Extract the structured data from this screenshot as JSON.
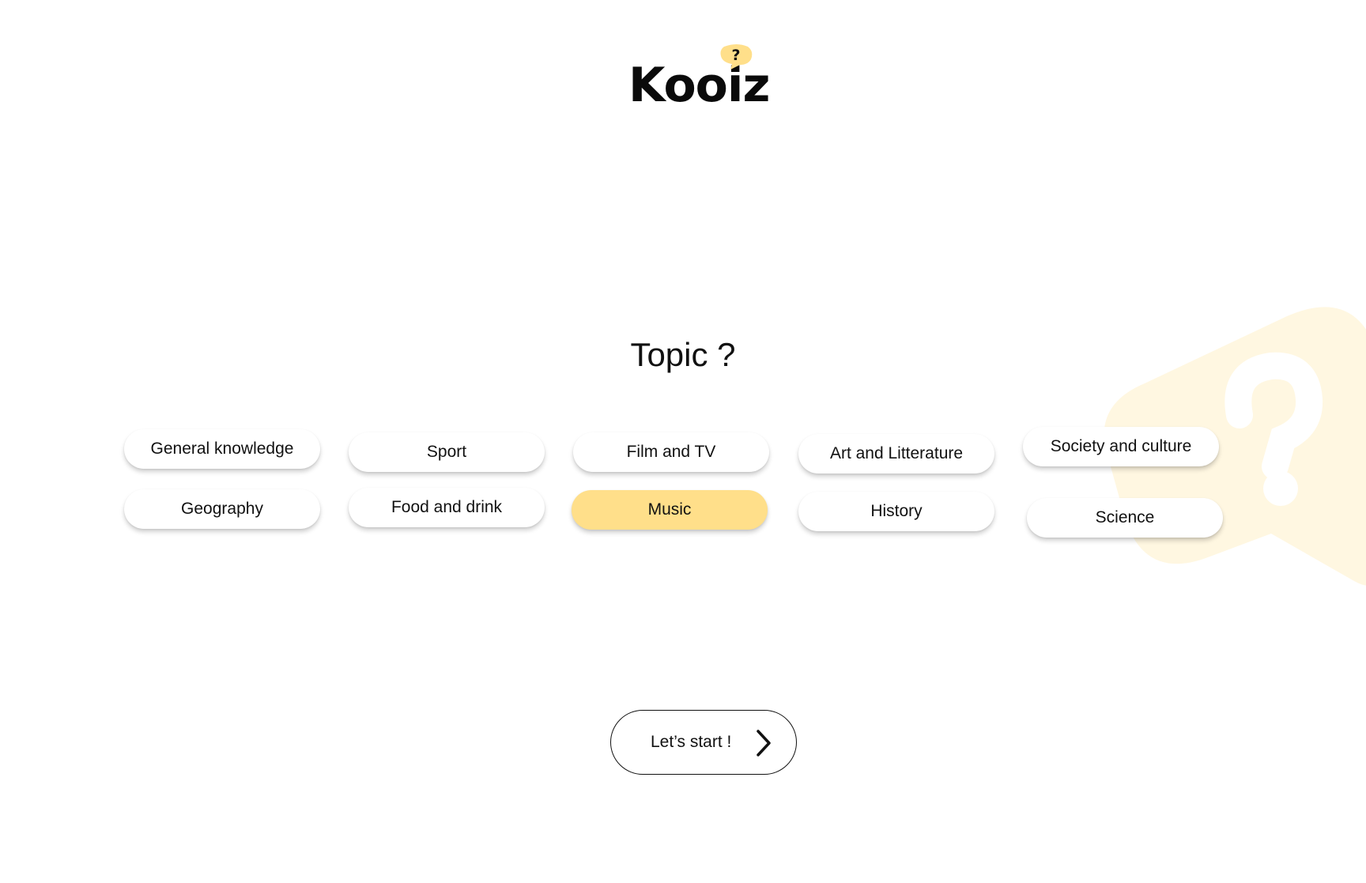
{
  "brand": {
    "name": "Kooiz",
    "bubble_glyph": "?",
    "accent_color": "#ffdf8a",
    "decoration_color": "#fff7e1"
  },
  "page": {
    "title": "Topic ?"
  },
  "topics": [
    {
      "label": "General knowledge",
      "selected": false
    },
    {
      "label": "Sport",
      "selected": false
    },
    {
      "label": "Film and TV",
      "selected": false
    },
    {
      "label": "Art and Litterature",
      "selected": false
    },
    {
      "label": "Society and culture",
      "selected": false
    },
    {
      "label": "Geography",
      "selected": false
    },
    {
      "label": "Food and drink",
      "selected": false
    },
    {
      "label": "Music",
      "selected": true
    },
    {
      "label": "History",
      "selected": false
    },
    {
      "label": "Science",
      "selected": false
    }
  ],
  "actions": {
    "start_label": "Let’s start !",
    "start_icon": "chevron-right-icon"
  }
}
